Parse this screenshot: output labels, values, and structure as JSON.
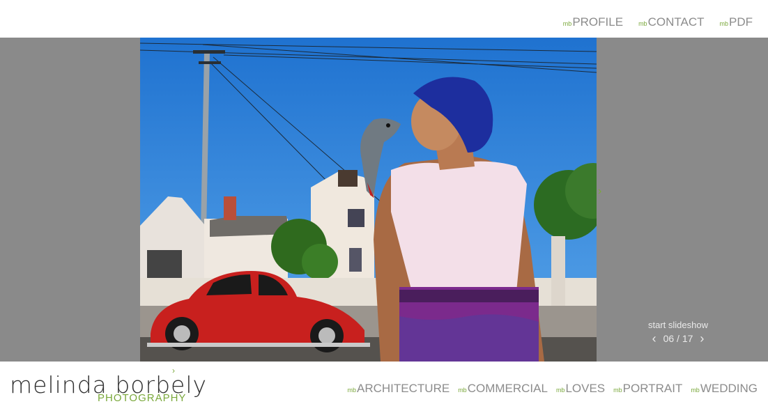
{
  "top_nav": {
    "prefix": "mb",
    "items": [
      "PROFILE",
      "CONTACT",
      "PDF"
    ]
  },
  "gallery": {
    "next_glyph": "›",
    "slideshow_label": "start slideshow",
    "prev_glyph": "‹",
    "next_small_glyph": "›",
    "counter": "06 / 17",
    "photo_alt": "Woman in blue headscarf with a parrot, red Volkswagen Beetle and houses in background"
  },
  "logo": {
    "name": "melinda borbely",
    "subtitle": "PHOTOGRAPHY"
  },
  "bottom_nav": {
    "prefix": "mb",
    "items": [
      "ARCHITECTURE",
      "COMMERCIAL",
      "LOVES",
      "PORTRAIT",
      "WEDDING"
    ]
  },
  "colors": {
    "accent": "#7aa83b",
    "nav_text": "#8c8c8c",
    "stage_bg": "#8a8a8a",
    "sky": "#2d7fd6",
    "car": "#c8201e",
    "headscarf": "#1d2e9e"
  }
}
